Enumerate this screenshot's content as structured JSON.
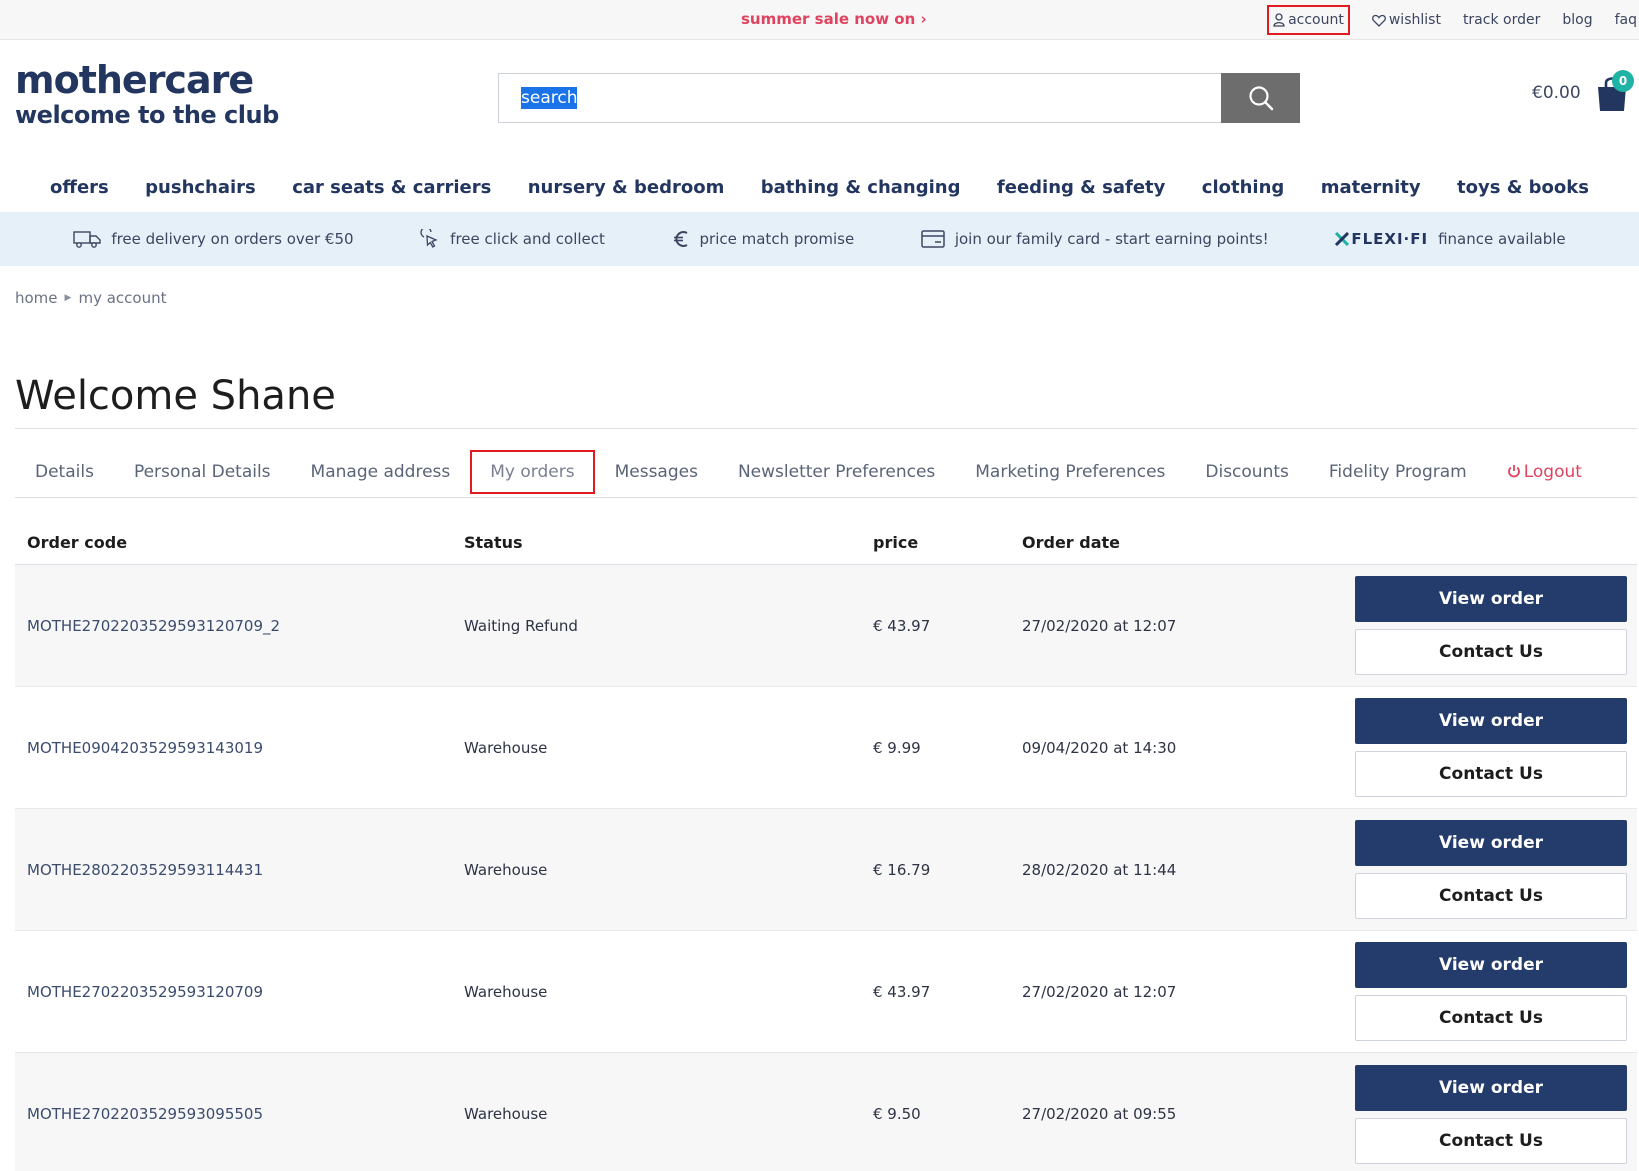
{
  "topbar": {
    "promo": "summer sale now on ›",
    "links": {
      "account": "account",
      "wishlist": "wishlist",
      "track_order": "track order",
      "blog": "blog",
      "faq": "faq"
    }
  },
  "header": {
    "logo_line1": "mothercare",
    "logo_line2": "welcome to the club",
    "search_value": "search",
    "basket_total": "€0.00",
    "basket_count": "0"
  },
  "nav": [
    "offers",
    "pushchairs",
    "car seats & carriers",
    "nursery & bedroom",
    "bathing & changing",
    "feeding & safety",
    "clothing",
    "maternity",
    "toys & books"
  ],
  "usp": {
    "delivery": "free delivery on orders over €50",
    "click_collect": "free click and collect",
    "price_match": "price match promise",
    "family_card": "join our family card - start earning points!",
    "flexi_logo": "FLEXI·FI",
    "finance": "finance available"
  },
  "breadcrumb": {
    "home": "home",
    "current": "my account"
  },
  "page_title": "Welcome Shane",
  "tabs": {
    "details": "Details",
    "personal_details": "Personal Details",
    "manage_address": "Manage address",
    "my_orders": "My orders",
    "messages": "Messages",
    "newsletter": "Newsletter Preferences",
    "marketing": "Marketing Preferences",
    "discounts": "Discounts",
    "fidelity": "Fidelity Program",
    "logout": "Logout"
  },
  "orders": {
    "headers": {
      "code": "Order code",
      "status": "Status",
      "price": "price",
      "date": "Order date"
    },
    "view_label": "View order",
    "contact_label": "Contact Us",
    "rows": [
      {
        "code": "MOTHE2702203529593120709_2",
        "status": "Waiting Refund",
        "price": "€ 43.97",
        "date": "27/02/2020 at 12:07"
      },
      {
        "code": "MOTHE0904203529593143019",
        "status": "Warehouse",
        "price": "€ 9.99",
        "date": "09/04/2020 at 14:30"
      },
      {
        "code": "MOTHE2802203529593114431",
        "status": "Warehouse",
        "price": "€ 16.79",
        "date": "28/02/2020 at 11:44"
      },
      {
        "code": "MOTHE2702203529593120709",
        "status": "Warehouse",
        "price": "€ 43.97",
        "date": "27/02/2020 at 12:07"
      },
      {
        "code": "MOTHE2702203529593095505",
        "status": "Warehouse",
        "price": "€ 9.50",
        "date": "27/02/2020 at 09:55"
      }
    ]
  },
  "colors": {
    "brand_navy": "#23365f",
    "promo_pink": "#e0435f",
    "highlight_red": "#e11b22",
    "usp_bg": "#e6f0f8",
    "badge_teal": "#1fb3a5"
  }
}
